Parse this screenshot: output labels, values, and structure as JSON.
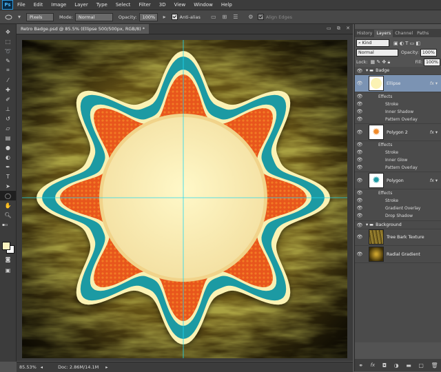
{
  "app": {
    "logo": "Ps"
  },
  "menu": [
    "File",
    "Edit",
    "Image",
    "Layer",
    "Type",
    "Select",
    "Filter",
    "3D",
    "View",
    "Window",
    "Help"
  ],
  "options": {
    "tool_icon": "ellipse-tool-icon",
    "mode_select": "Pixels",
    "mode_label": "Mode:",
    "mode_value": "Normal",
    "opacity_label": "Opacity:",
    "opacity_value": "100%",
    "antialias_label": "Anti-alias",
    "align_edges_label": "Align Edges"
  },
  "document": {
    "tab_title": "Retro Badge.psd @ 85.5% (Ellipse 500/500px, RGB/8) *",
    "zoom": "85.53%",
    "doc_size": "Doc: 2.86M/14.1M"
  },
  "panel": {
    "tabs": [
      "History",
      "Layers",
      "Channel",
      "Paths"
    ],
    "kind_label": "Kind",
    "blend_mode": "Normal",
    "opacity_label": "Opacity:",
    "opacity_value": "100%",
    "lock_label": "Lock:",
    "fill_label": "Fill:",
    "fill_value": "100%"
  },
  "layers": {
    "group_badge": "Badge",
    "ellipse": {
      "name": "Ellipse",
      "effects_label": "Effects",
      "effects": [
        "Stroke",
        "Inner Shadow",
        "Pattern Overlay"
      ]
    },
    "polygon2": {
      "name": "Polygon 2",
      "effects_label": "Effects",
      "effects": [
        "Stroke",
        "Inner Glow",
        "Pattern Overlay"
      ]
    },
    "polygon": {
      "name": "Polygon",
      "effects_label": "Effects",
      "effects": [
        "Stroke",
        "Gradient Overlay",
        "Drop Shadow"
      ]
    },
    "group_background": "Background",
    "tree_bark": "Tree Bark Texture",
    "radial": "Radial Gradient"
  },
  "colors": {
    "accent_selection": "#7b93b3",
    "badge_teal": "#1f9aa3",
    "badge_orange": "#e9571b",
    "badge_cream": "#fbf2b4",
    "guide": "#00d8ff"
  }
}
